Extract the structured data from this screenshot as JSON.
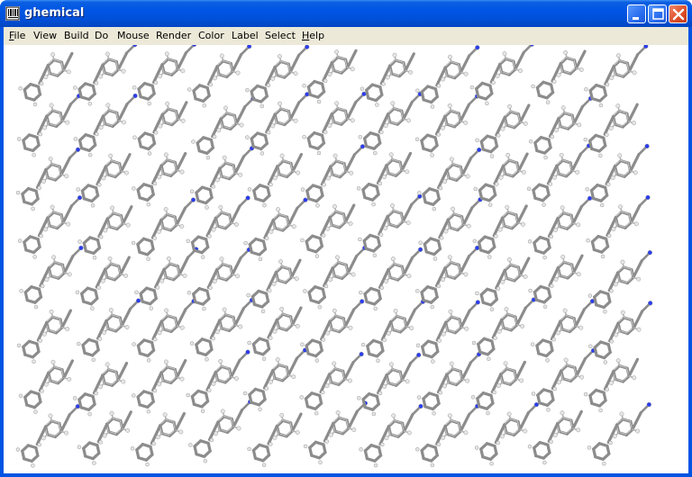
{
  "window": {
    "title": "ghemical",
    "icon": "barcode-app-icon",
    "buttons": [
      "minimize-icon",
      "maximize-icon",
      "close-icon"
    ]
  },
  "menu": {
    "items": [
      {
        "label": "File",
        "mnemonic": "F",
        "rest": "ile"
      },
      {
        "label": "View",
        "mnemonic": "",
        "rest": "View"
      },
      {
        "label": "Build",
        "mnemonic": "",
        "rest": "Build"
      },
      {
        "label": "Do",
        "mnemonic": "",
        "rest": "Do"
      },
      {
        "label": "Mouse",
        "mnemonic": "",
        "rest": "Mouse"
      },
      {
        "label": "Render",
        "mnemonic": "",
        "rest": "Render"
      },
      {
        "label": "Color",
        "mnemonic": "",
        "rest": "Color"
      },
      {
        "label": "Label",
        "mnemonic": "",
        "rest": "Label"
      },
      {
        "label": "Select",
        "mnemonic": "",
        "rest": "Select"
      },
      {
        "label": "Help",
        "mnemonic": "H",
        "rest": "elp"
      }
    ]
  },
  "colors": {
    "carbon": "#8c8c8c",
    "carbon_highlight": "#c8c8c8",
    "hydrogen": "#e6e6e6",
    "nitrogen": "#2a3cf0",
    "background": "#ffffff"
  },
  "scene": {
    "description_type": "molecular-crystal-lattice",
    "render_mode": "ball-and-stick"
  }
}
